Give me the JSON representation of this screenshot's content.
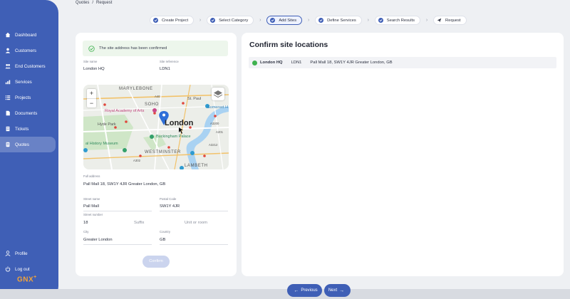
{
  "sidebar": {
    "items": [
      {
        "label": "Dashboard",
        "icon": "home-icon"
      },
      {
        "label": "Customers",
        "icon": "person-icon"
      },
      {
        "label": "End Customers",
        "icon": "people-icon"
      },
      {
        "label": "Services",
        "icon": "services-icon"
      },
      {
        "label": "Projects",
        "icon": "list-icon"
      },
      {
        "label": "Documents",
        "icon": "document-icon"
      },
      {
        "label": "Tickets",
        "icon": "ticket-icon"
      },
      {
        "label": "Quotes",
        "icon": "quote-icon",
        "active": true
      }
    ],
    "bottom": [
      {
        "label": "Profile",
        "icon": "person-icon"
      },
      {
        "label": "Log out",
        "icon": "power-icon"
      }
    ],
    "logo": "GNX",
    "logo_mark": "+"
  },
  "breadcrumb": {
    "parent": "Quotes",
    "separator": "/",
    "current": "Request"
  },
  "stepper": {
    "steps": [
      {
        "label": "Create Project",
        "state": "done"
      },
      {
        "label": "Select Category",
        "state": "done"
      },
      {
        "label": "Add Sites",
        "state": "active"
      },
      {
        "label": "Define Services",
        "state": "pending"
      },
      {
        "label": "Search Results",
        "state": "pending"
      },
      {
        "label": "Request",
        "state": "pending"
      }
    ]
  },
  "form": {
    "banner": "The site address has been confirmed",
    "site_name_label": "Site name",
    "site_name": "London HQ",
    "site_ref_label": "Site reference",
    "site_ref": "LDN1",
    "full_address_label": "Full address",
    "full_address": "Pall Mall 18, SW1Y 4JR Greater London, GB",
    "street_label": "Street name",
    "street": "Pall Mall",
    "postal_label": "Postal Code",
    "postal": "SW1Y 4JR",
    "number_label": "Street number",
    "number": "18",
    "suffix_placeholder": "Suffix",
    "unit_placeholder": "Unit or room",
    "city_label": "City",
    "city": "Greater London",
    "country_label": "Country",
    "country": "GB",
    "confirm_button": "Confirm"
  },
  "map": {
    "labels": {
      "marylebone": "MARYLEBONE",
      "soho": "SOHO",
      "st_paul": "St. Paul",
      "somerset": "Somerset H",
      "royal_academy": "Royal Academy of Arts",
      "hyde_park": "Hyde Park",
      "london": "London",
      "buckingham": "Buckingham Palace",
      "natural_history": "al History Museum",
      "westminster": "WESTMINSTER",
      "lambeth": "LAMBETH",
      "a40": "A40",
      "a3200": "A3200",
      "a201": "A201",
      "a302": "A302",
      "a3212": "A3212"
    },
    "zoom_in": "+",
    "zoom_out": "−"
  },
  "confirm_panel": {
    "title": "Confirm site locations",
    "rows": [
      {
        "name": "London HQ",
        "ref": "LDN1",
        "address": "Pall Mall 18, SW1Y 4JR Greater London, GB"
      }
    ]
  },
  "footer": {
    "previous": "Previous",
    "next": "Next"
  },
  "colors": {
    "primary": "#3f5fb6",
    "success": "#3fb24f",
    "logo": "#f2a33a"
  }
}
